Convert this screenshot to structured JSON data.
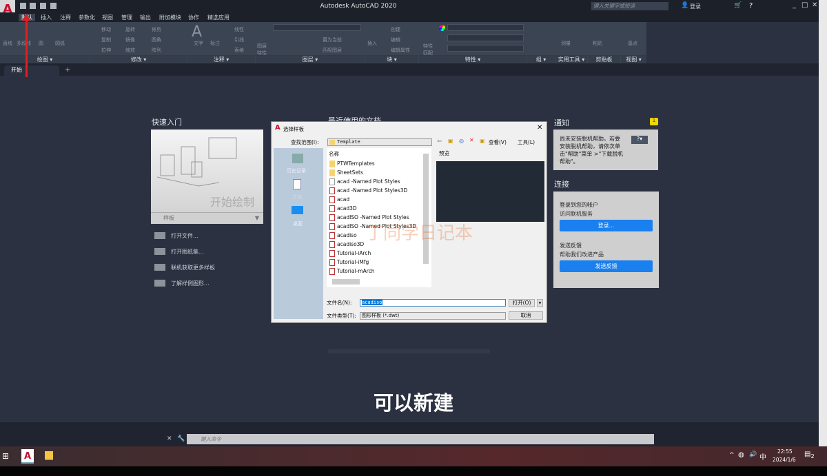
{
  "window": {
    "title": "Autodesk AutoCAD 2020",
    "search_placeholder": "键入关键字或短语",
    "login": "登录",
    "window_controls": [
      "minimize",
      "maximize",
      "close"
    ]
  },
  "menu_tabs": [
    "默认",
    "插入",
    "注释",
    "参数化",
    "视图",
    "管理",
    "输出",
    "附加模块",
    "协作",
    "精选应用"
  ],
  "ribbon": {
    "panels": [
      "绘图",
      "修改",
      "注释",
      "图层",
      "块",
      "特性",
      "组",
      "实用工具",
      "剪贴板",
      "视图"
    ],
    "draw_tools": [
      "直线",
      "多段线",
      "圆",
      "圆弧"
    ],
    "modify_tools": [
      "移动",
      "旋转",
      "修剪",
      "复制",
      "镜像",
      "圆角",
      "拉伸",
      "缩放",
      "阵列"
    ],
    "annotation_tools": [
      "文字",
      "标注",
      "线性",
      "引线",
      "表格"
    ],
    "layer_tools": [
      "图层特性",
      "置为当前",
      "匹配图层"
    ],
    "block_tools": [
      "插入",
      "创建",
      "编辑",
      "编辑属性"
    ],
    "property_tools": [
      "特性匹配"
    ],
    "utility_tools": [
      "测量"
    ],
    "clipboard_tools": [
      "粘贴"
    ],
    "view_tools": [
      "基点"
    ]
  },
  "doc_tabs": {
    "active": "开始",
    "add": "+"
  },
  "quick_start": {
    "title": "快速入门",
    "start_drawing": "开始绘制",
    "template_label": "样板",
    "links": [
      "打开文件...",
      "打开图纸集...",
      "联机获取更多样板",
      "了解样例图形..."
    ]
  },
  "recent_docs": {
    "title": "最近使用的文档"
  },
  "notifications": {
    "title": "通知",
    "count": "1",
    "message": "尚未安装脱机帮助。若要安装脱机帮助，请依次单击\"帮助\"菜单 >\"下载脱机帮助\"。"
  },
  "connect": {
    "title": "连接",
    "login_heading": "登录到您的帐户",
    "login_sub": "访问联机服务",
    "login_button": "登录...",
    "feedback_heading": "发送反馈",
    "feedback_sub": "帮助我们改进产品",
    "feedback_button": "发送反馈"
  },
  "dialog": {
    "title": "选择样板",
    "look_in_label": "查找范围(I):",
    "look_in_value": "Template",
    "view_label": "查看(V)",
    "tools_label": "工具(L)",
    "places": [
      "历史记录",
      "文档",
      "桌面"
    ],
    "column_name": "名称",
    "preview_label": "预览",
    "files": [
      {
        "name": "PTWTemplates",
        "type": "folder"
      },
      {
        "name": "SheetSets",
        "type": "folder"
      },
      {
        "name": "acad -Named Plot Styles",
        "type": "doc"
      },
      {
        "name": "acad -Named Plot Styles3D",
        "type": "dwt"
      },
      {
        "name": "acad",
        "type": "dwt"
      },
      {
        "name": "acad3D",
        "type": "dwt"
      },
      {
        "name": "acadISO -Named Plot Styles",
        "type": "dwt"
      },
      {
        "name": "acadISO -Named Plot Styles3D",
        "type": "dwt"
      },
      {
        "name": "acadiso",
        "type": "dwt"
      },
      {
        "name": "acadiso3D",
        "type": "dwt"
      },
      {
        "name": "Tutorial-iArch",
        "type": "dwt"
      },
      {
        "name": "Tutorial-iMfg",
        "type": "dwt"
      },
      {
        "name": "Tutorial-mArch",
        "type": "dwt"
      }
    ],
    "filename_label": "文件名(N):",
    "filename_value": "acadiso",
    "filetype_label": "文件类型(T):",
    "filetype_value": "图形样板 (*.dwt)",
    "open_button": "打开(O)",
    "cancel_button": "取消"
  },
  "watermark": "丁同学日记本",
  "caption": "可以新建",
  "command_line": {
    "placeholder": "键入命令"
  },
  "taskbar": {
    "ime": "中",
    "time": "22:55",
    "date": "2024/1/6",
    "notifications": "2"
  },
  "colors": {
    "accent_blue": "#1a80f0",
    "brand_red": "#c8102e",
    "annotation_arrow": "#e02020"
  }
}
